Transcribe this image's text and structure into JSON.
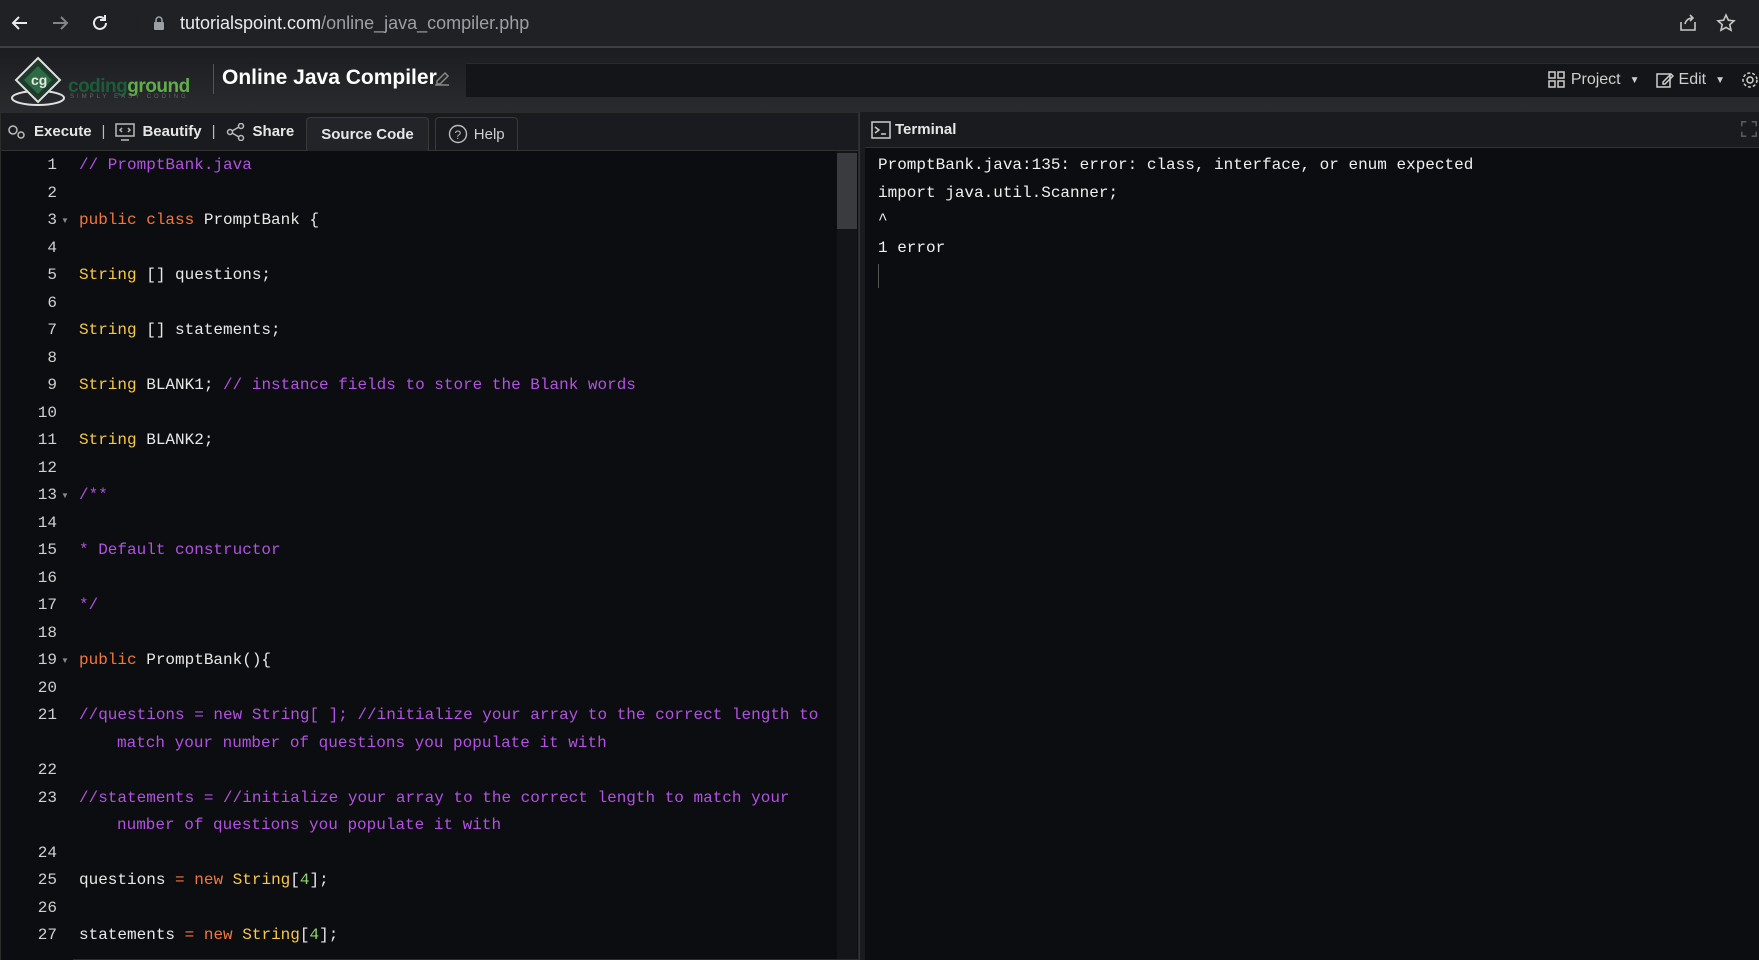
{
  "browser": {
    "url_host": "tutorialspoint.com",
    "url_path": "/online_java_compiler.php",
    "icons": [
      "back-arrow-icon",
      "forward-arrow-icon",
      "reload-icon",
      "lock-icon",
      "share-icon",
      "star-icon"
    ]
  },
  "header": {
    "logo_coding": "coding",
    "logo_ground": "ground",
    "logo_tagline": "SIMPLY EASY CODING",
    "title": "Online Java Compiler",
    "project_label": "Project",
    "edit_label": "Edit"
  },
  "toolbar": {
    "execute_label": "Execute",
    "beautify_label": "Beautify",
    "share_label": "Share",
    "source_code_label": "Source Code",
    "help_label": "Help",
    "pipe": "|"
  },
  "editor": {
    "lines": [
      {
        "n": "1",
        "segs": [
          [
            "cm",
            "// PromptBank.java"
          ]
        ]
      },
      {
        "n": "2",
        "segs": []
      },
      {
        "n": "3",
        "fold": true,
        "segs": [
          [
            "kw",
            "public"
          ],
          [
            "op",
            " "
          ],
          [
            "kw",
            "class"
          ],
          [
            "op",
            " PromptBank {"
          ]
        ]
      },
      {
        "n": "4",
        "segs": []
      },
      {
        "n": "5",
        "segs": [
          [
            "ty",
            "String"
          ],
          [
            "op",
            " [] questions;"
          ]
        ]
      },
      {
        "n": "6",
        "segs": []
      },
      {
        "n": "7",
        "segs": [
          [
            "ty",
            "String"
          ],
          [
            "op",
            " [] statements;"
          ]
        ]
      },
      {
        "n": "8",
        "segs": []
      },
      {
        "n": "9",
        "segs": [
          [
            "ty",
            "String"
          ],
          [
            "op",
            " BLANK1; "
          ],
          [
            "cm",
            "// instance fields to store the Blank words"
          ]
        ]
      },
      {
        "n": "10",
        "segs": []
      },
      {
        "n": "11",
        "segs": [
          [
            "ty",
            "String"
          ],
          [
            "op",
            " BLANK2;"
          ]
        ]
      },
      {
        "n": "12",
        "segs": []
      },
      {
        "n": "13",
        "fold": true,
        "segs": [
          [
            "cm",
            "/**"
          ]
        ]
      },
      {
        "n": "14",
        "segs": []
      },
      {
        "n": "15",
        "segs": [
          [
            "cm",
            "* Default constructor"
          ]
        ]
      },
      {
        "n": "16",
        "segs": []
      },
      {
        "n": "17",
        "segs": [
          [
            "cm",
            "*/"
          ]
        ]
      },
      {
        "n": "18",
        "segs": []
      },
      {
        "n": "19",
        "fold": true,
        "segs": [
          [
            "kw",
            "public"
          ],
          [
            "op",
            " PromptBank(){"
          ]
        ]
      },
      {
        "n": "20",
        "segs": []
      },
      {
        "n": "21",
        "wrap": "match your number of questions you populate it with",
        "segs": [
          [
            "cm",
            "//questions = new String[ ]; //initialize your array to the correct length to"
          ]
        ]
      },
      {
        "n": "22",
        "segs": []
      },
      {
        "n": "23",
        "wrap": "number of questions you populate it with",
        "segs": [
          [
            "cm",
            "//statements = //initialize your array to the correct length to match your"
          ]
        ]
      },
      {
        "n": "24",
        "segs": []
      },
      {
        "n": "25",
        "segs": [
          [
            "op",
            "questions "
          ],
          [
            "kw",
            "="
          ],
          [
            "op",
            " "
          ],
          [
            "kw",
            "new"
          ],
          [
            "op",
            " "
          ],
          [
            "ty",
            "String"
          ],
          [
            "op",
            "["
          ],
          [
            "nm",
            "4"
          ],
          [
            "op",
            "];"
          ]
        ]
      },
      {
        "n": "26",
        "segs": []
      },
      {
        "n": "27",
        "segs": [
          [
            "op",
            "statements "
          ],
          [
            "kw",
            "="
          ],
          [
            "op",
            " "
          ],
          [
            "kw",
            "new"
          ],
          [
            "op",
            " "
          ],
          [
            "ty",
            "String"
          ],
          [
            "op",
            "["
          ],
          [
            "nm",
            "4"
          ],
          [
            "op",
            "];"
          ]
        ]
      }
    ]
  },
  "terminal": {
    "title": "Terminal",
    "output": [
      "PromptBank.java:135: error: class, interface, or enum expected",
      "import java.util.Scanner;",
      "^",
      "1 error"
    ]
  },
  "colors": {
    "keyword": "#f3783d",
    "type": "#f7c948",
    "comment": "#b152e0",
    "number": "#8fd26b",
    "background": "#0c0d10"
  }
}
